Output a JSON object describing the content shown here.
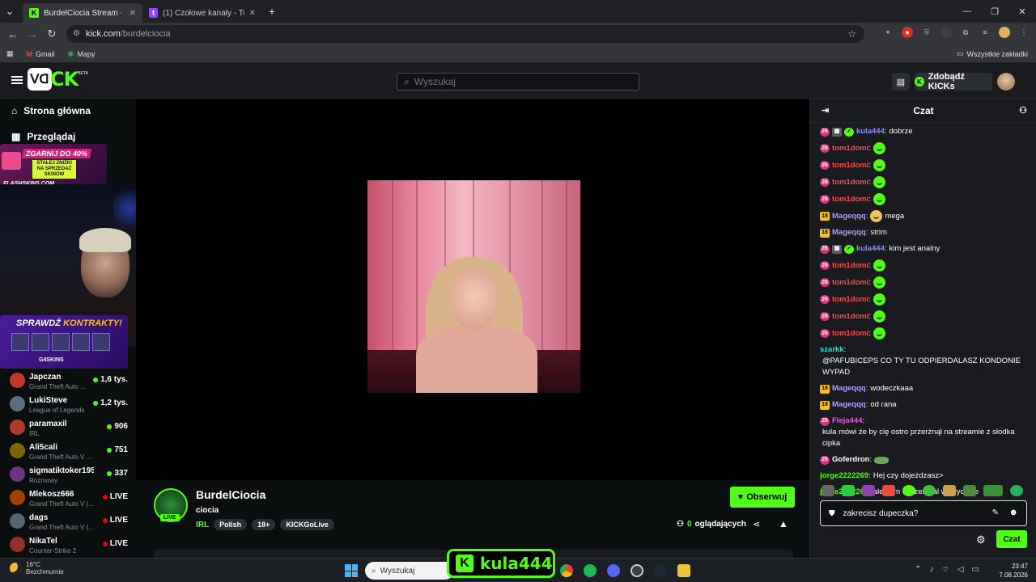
{
  "browser": {
    "tabs": [
      {
        "title": "BurdelCiocia Stream - Watc",
        "active": true
      },
      {
        "title": "(1) Czołowe kanały - Twitch",
        "active": false
      }
    ],
    "new_tab": "+",
    "url_host": "kick.com",
    "url_path": "/burdelciocia",
    "bookmarks": [
      "Gmail",
      "Mapy"
    ],
    "all_bookmarks": "Wszystkie zakładki"
  },
  "header": {
    "logo_letters": "CK",
    "logo_beta": "BETA",
    "search_placeholder": "Wyszukaj",
    "get_kicks": "Zdobądź KICKs"
  },
  "sidebar": {
    "nav": [
      {
        "label": "Strona główna",
        "icon": "home-icon"
      },
      {
        "label": "Przeglądaj",
        "icon": "browse-icon"
      }
    ],
    "promo1": {
      "headline": "ZGARNIJ DO 40%",
      "sub": "STAŁEJ ZNIŻKI NA SPRZEDAŻ SKINÓW",
      "brand": "FLASHSKINS.COM"
    },
    "promo2": {
      "headline_a": "SPRAWDŹ ",
      "headline_b": "KONTRAKTY!",
      "brand": "G4SKINS"
    },
    "channels": [
      {
        "name": "Japczan",
        "game": "Grand Theft Auto ...",
        "viewers": "1,6 tys.",
        "status": "green",
        "color": "#c0392b"
      },
      {
        "name": "LukiSteve",
        "game": "League of Legends",
        "viewers": "1,2 tys.",
        "status": "green",
        "color": "#5d6d7e"
      },
      {
        "name": "paramaxil",
        "game": "IRL",
        "viewers": "906",
        "status": "green",
        "color": "#b03a2e"
      },
      {
        "name": "Ali5cali",
        "game": "Grand Theft Auto V (G...",
        "viewers": "751",
        "status": "green",
        "color": "#7d6608"
      },
      {
        "name": "sigmatiktoker1959",
        "game": "Rozmowy",
        "viewers": "337",
        "status": "green",
        "color": "#6c3483"
      },
      {
        "name": "Mlekosz666",
        "game": "Grand Theft Auto V (...",
        "viewers": "LIVE",
        "status": "red",
        "color": "#a04000"
      },
      {
        "name": "dags",
        "game": "Grand Theft Auto V (...",
        "viewers": "LIVE",
        "status": "red",
        "color": "#566573"
      },
      {
        "name": "NikaTel",
        "game": "Counter-Strike 2",
        "viewers": "LIVE",
        "status": "red",
        "color": "#943126"
      }
    ]
  },
  "channel": {
    "name": "BurdelCiocia",
    "title": "ciocia",
    "category": "IRL",
    "tags": [
      "Polish",
      "18+",
      "KICKGoLive"
    ],
    "live_badge": "LIVE",
    "follow": "Obserwuj",
    "viewers_count": "0",
    "viewers_label": "oglądających"
  },
  "chat": {
    "title": "Czat",
    "messages": [
      {
        "badges": [
          "pink",
          "gray",
          "grn"
        ],
        "user": "kula444",
        "color": "#8e8cff",
        "text": "dobrze",
        "emote": ""
      },
      {
        "badges": [
          "pink"
        ],
        "user": "tom1domi",
        "color": "#ff4a4a",
        "text": "",
        "emote": "g"
      },
      {
        "badges": [
          "pink"
        ],
        "user": "tom1domi",
        "color": "#ff4a4a",
        "text": "",
        "emote": "g"
      },
      {
        "badges": [
          "pink"
        ],
        "user": "tom1domi",
        "color": "#ff4a4a",
        "text": "",
        "emote": "g"
      },
      {
        "badges": [
          "pink"
        ],
        "user": "tom1domi",
        "color": "#ff4a4a",
        "text": "",
        "emote": "g"
      },
      {
        "badges": [
          "yel"
        ],
        "user": "Mageqqq",
        "color": "#b49cff",
        "text": "mega",
        "emote": "y"
      },
      {
        "badges": [
          "yel"
        ],
        "user": "Mageqqq",
        "color": "#b49cff",
        "text": "strim",
        "emote": ""
      },
      {
        "badges": [
          "pink",
          "gray",
          "grn"
        ],
        "user": "kula444",
        "color": "#8e8cff",
        "text": "kim jest analny",
        "emote": ""
      },
      {
        "badges": [
          "pink"
        ],
        "user": "tom1domi",
        "color": "#ff4a4a",
        "text": "",
        "emote": "g"
      },
      {
        "badges": [
          "pink"
        ],
        "user": "tom1domi",
        "color": "#ff4a4a",
        "text": "",
        "emote": "g"
      },
      {
        "badges": [
          "pink"
        ],
        "user": "tom1domi",
        "color": "#ff4a4a",
        "text": "",
        "emote": "g"
      },
      {
        "badges": [
          "pink"
        ],
        "user": "tom1domi",
        "color": "#ff4a4a",
        "text": "",
        "emote": "g"
      },
      {
        "badges": [
          "pink"
        ],
        "user": "tom1domi",
        "color": "#ff4a4a",
        "text": "",
        "emote": "g"
      },
      {
        "badges": [],
        "user": "szarkk",
        "color": "#3fd6d6",
        "text": "@PAFUBICEPS CO TY TU ODPIERDALASZ KONDONIE WYPAD",
        "emote": ""
      },
      {
        "badges": [
          "yel"
        ],
        "user": "Mageqqq",
        "color": "#b49cff",
        "text": "wodeczkaaa",
        "emote": ""
      },
      {
        "badges": [
          "yel"
        ],
        "user": "Mageqqq",
        "color": "#b49cff",
        "text": "od rana",
        "emote": ""
      },
      {
        "badges": [
          "pink"
        ],
        "user": "Fleja444",
        "color": "#e05ad8",
        "text": "kula mówi że by cię ostro przerżnął na streamie z słodka cipka",
        "emote": ""
      },
      {
        "badges": [
          "pink"
        ],
        "user": "Goferdron",
        "color": "#ffffff",
        "text": "",
        "emote": "t"
      },
      {
        "badges": [],
        "user": "jorge2222269",
        "color": "#53fc18",
        "text": "Hej czy dojeżdzasz>",
        "emote": ""
      },
      {
        "badges": [],
        "user": "jorge2222269",
        "color": "#53fc18",
        "text": "ale bym cie zerznal w cyycunie",
        "emote": ""
      }
    ],
    "input_value": "zakrecisz dupeczka?",
    "send": "Czat"
  },
  "taskbar": {
    "temp": "16°C",
    "weather": "Bezchmurnie",
    "search": "Wyszukaj",
    "time": "23:47",
    "date": "7.08.2026"
  },
  "overlay": {
    "user": "kula444",
    "badge": "K"
  }
}
